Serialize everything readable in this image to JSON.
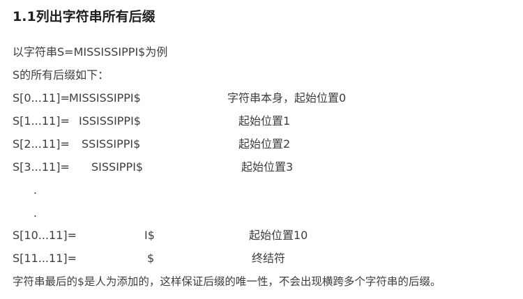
{
  "heading": "1.1列出字符串所有后缀",
  "intro": "以字符串S=MISSISSIPPI$为例",
  "intro2": "S的所有后缀如下：",
  "rows": [
    {
      "index": "S[0...11]=",
      "suffix": "MISSISSIPPI$",
      "note": "字符串本身，起始位置0"
    },
    {
      "index": "S[1...11]=",
      "suffix": "ISSISSIPPI$",
      "note": "起始位置1"
    },
    {
      "index": "S[2...11]=",
      "suffix": "SSISSIPPI$",
      "note": "起始位置2"
    },
    {
      "index": "S[3...11]=",
      "suffix": "SISSIPPI$",
      "note": "起始位置3"
    },
    {
      "index": "S[10...11]=",
      "suffix": "I$",
      "note": "起始位置10"
    },
    {
      "index": "S[11...11]=",
      "suffix": "$",
      "note": "终结符"
    }
  ],
  "ellipsis": ".",
  "footer": "字符串最后的$是人为添加的，这样保证后缀的唯一性，不会出现横跨多个字符串的后缀。"
}
